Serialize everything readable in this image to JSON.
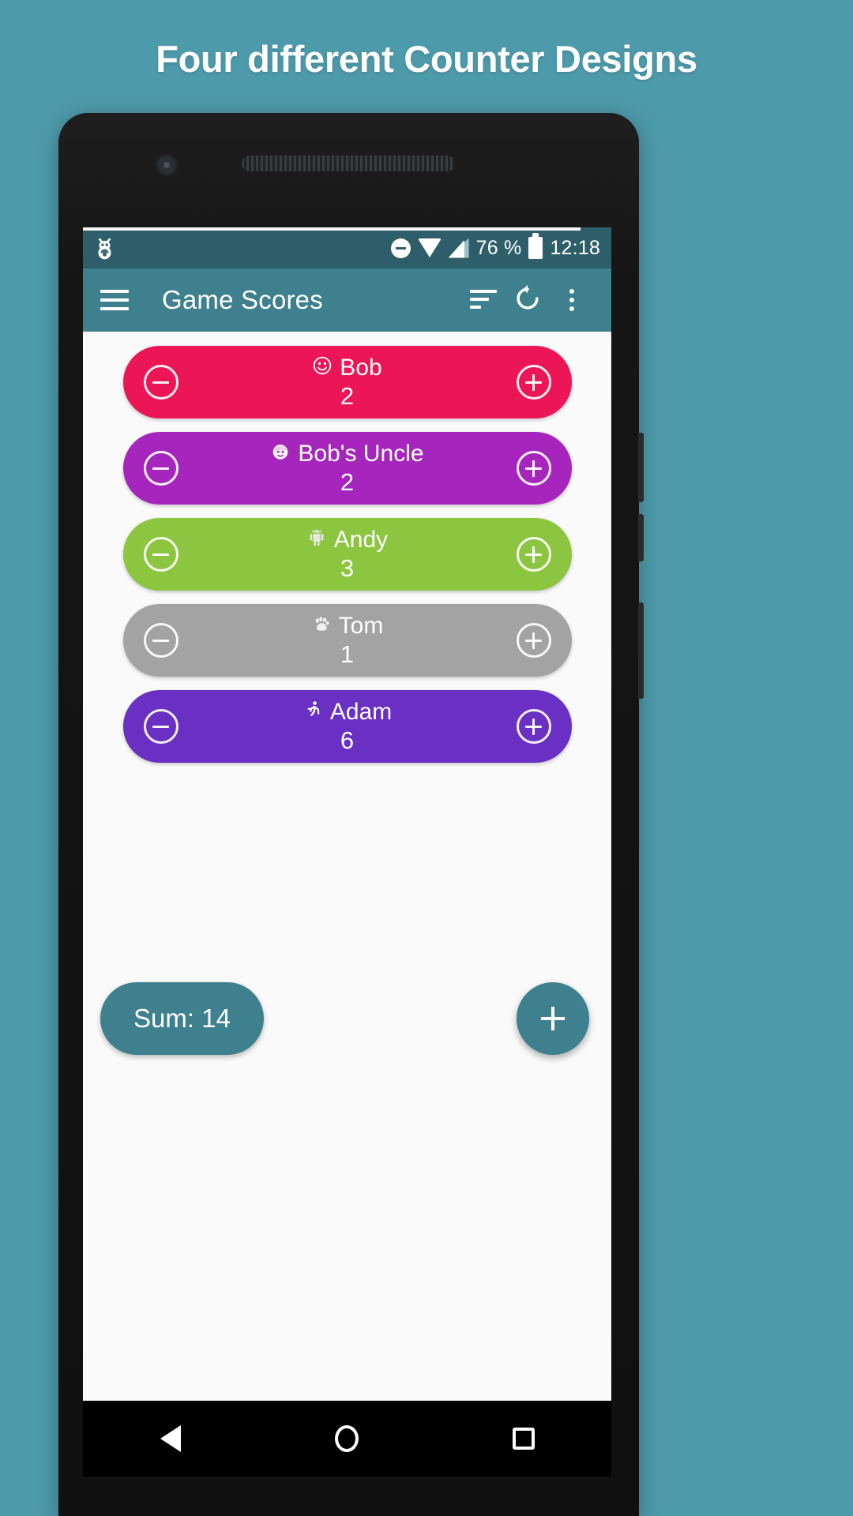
{
  "headline": "Four different Counter Designs",
  "theme": {
    "background": "#4d9aab",
    "statusbar_bg": "#2e5e6a",
    "appbar_bg": "#3e808e",
    "accent": "#3e808e",
    "screen_bg": "#fafafa"
  },
  "statusbar": {
    "bug_icon": "bug-icon",
    "dnd_icon": "do-not-disturb-icon",
    "wifi_icon": "wifi-icon",
    "signal_icon": "cellular-signal-icon",
    "battery_percent": "76 %",
    "battery_icon": "battery-icon",
    "time": "12:18"
  },
  "appbar": {
    "menu_icon": "hamburger-menu-icon",
    "title": "Game Scores",
    "sort_icon": "sort-icon",
    "reset_icon": "reset-icon",
    "overflow_icon": "overflow-menu-icon"
  },
  "counters": [
    {
      "name": "Bob",
      "value": "2",
      "emoji": "☺",
      "emoji_name": "smiley-face-icon",
      "color": "#ec1556",
      "text_color": "#ffffff"
    },
    {
      "name": "Bob's Uncle",
      "value": "2",
      "emoji": "☻",
      "emoji_name": "baby-face-icon",
      "color": "#a626bd",
      "text_color": "#ffffff"
    },
    {
      "name": "Andy",
      "value": "3",
      "emoji": "⚙",
      "emoji_name": "android-robot-icon",
      "color": "#8cc540",
      "text_color": "#ffffff"
    },
    {
      "name": "Tom",
      "value": "1",
      "emoji": "✿",
      "emoji_name": "paw-print-icon",
      "color": "#a3a3a3",
      "text_color": "#ffffff"
    },
    {
      "name": "Adam",
      "value": "6",
      "emoji": "♁",
      "emoji_name": "running-person-icon",
      "color": "#6930c3",
      "text_color": "#ffffff"
    }
  ],
  "buttons": {
    "decrement_label": "−",
    "increment_label": "+"
  },
  "footer": {
    "sum_label": "Sum: 14",
    "fab_label": "+",
    "fab_name": "add-counter-fab"
  },
  "navbar": {
    "back": "back-button",
    "home": "home-button",
    "recents": "recents-button"
  }
}
